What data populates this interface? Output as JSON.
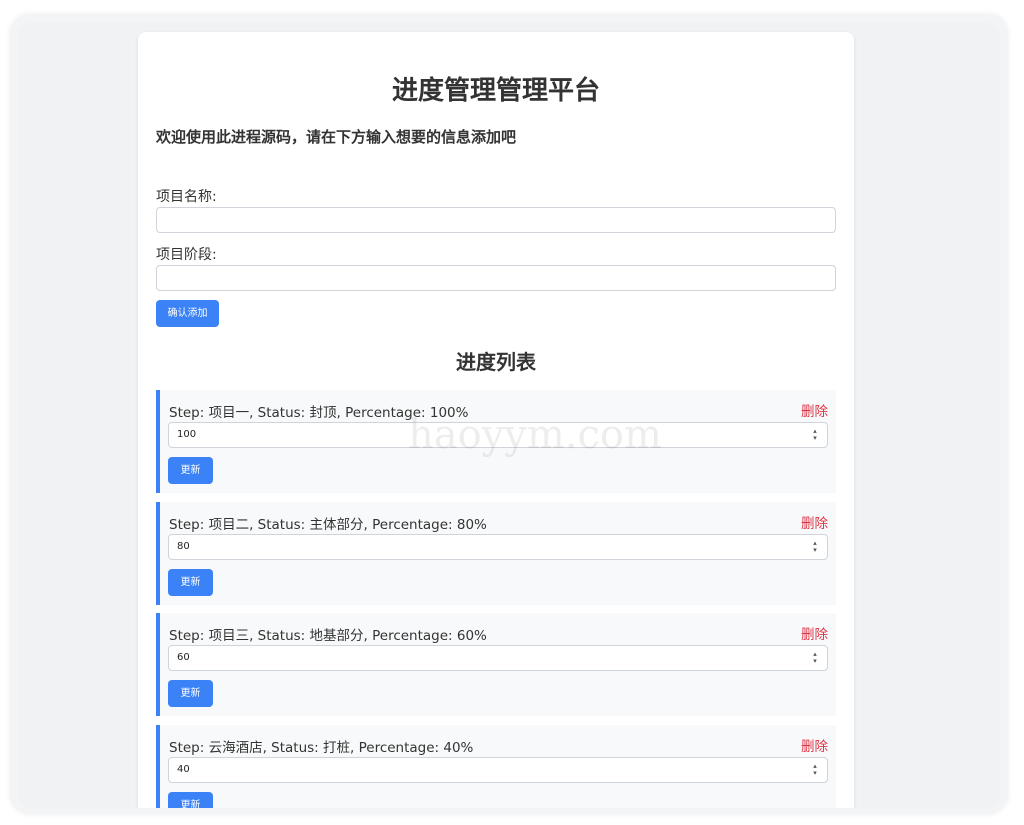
{
  "page": {
    "title": "进度管理管理平台",
    "welcome": "欢迎使用此进程源码，请在下方输入想要的信息添加吧"
  },
  "form": {
    "name_label": "项目名称:",
    "name_value": "",
    "stage_label": "项目阶段:",
    "stage_value": "",
    "submit_label": "确认添加"
  },
  "list": {
    "title": "进度列表",
    "items": [
      {
        "text": "Step: 项目一, Status: 封顶, Percentage: 100%",
        "value": "100",
        "delete_label": "删除",
        "update_label": "更新"
      },
      {
        "text": "Step: 项目二, Status: 主体部分, Percentage: 80%",
        "value": "80",
        "delete_label": "删除",
        "update_label": "更新"
      },
      {
        "text": "Step: 项目三, Status: 地基部分, Percentage: 60%",
        "value": "60",
        "delete_label": "删除",
        "update_label": "更新"
      },
      {
        "text": "Step: 云海酒店, Status: 打桩, Percentage: 40%",
        "value": "40",
        "delete_label": "删除",
        "update_label": "更新"
      }
    ]
  },
  "watermark": "haoyym.com",
  "colors": {
    "accent": "#3b82f6",
    "danger": "#dc3545",
    "text": "#333333"
  }
}
